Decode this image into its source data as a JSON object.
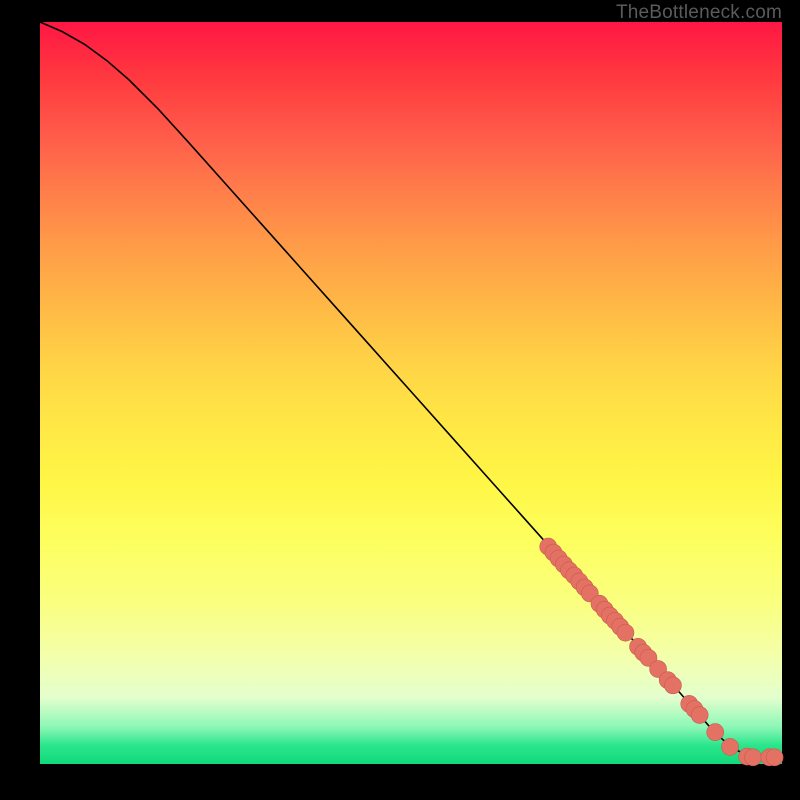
{
  "attribution": "TheBottleneck.com",
  "colors": {
    "background": "#000000",
    "marker_fill": "#e37264",
    "marker_stroke": "#c95a4e",
    "curve": "#000000"
  },
  "chart_data": {
    "type": "line",
    "title": "",
    "xlabel": "",
    "ylabel": "",
    "xlim": [
      0,
      100
    ],
    "ylim": [
      0,
      100
    ],
    "grid": false,
    "curve": {
      "x": [
        0,
        3,
        6,
        9,
        12,
        16,
        20,
        25,
        30,
        35,
        40,
        45,
        50,
        55,
        60,
        65,
        70,
        75,
        80,
        85,
        88,
        90,
        92,
        94,
        96,
        98,
        100
      ],
      "y": [
        100,
        98.7,
        97.0,
        94.8,
        92.2,
        88.2,
        83.8,
        78.2,
        72.6,
        67.0,
        61.4,
        55.8,
        50.2,
        44.6,
        39.0,
        33.4,
        27.8,
        22.2,
        16.6,
        11.0,
        7.6,
        5.3,
        3.3,
        1.8,
        1.0,
        0.9,
        0.9
      ]
    },
    "series": [
      {
        "name": "markers",
        "points": [
          {
            "x": 68.5,
            "y": 29.3
          },
          {
            "x": 69.2,
            "y": 28.5
          },
          {
            "x": 69.9,
            "y": 27.7
          },
          {
            "x": 70.6,
            "y": 26.9
          },
          {
            "x": 71.3,
            "y": 26.1
          },
          {
            "x": 72.0,
            "y": 25.4
          },
          {
            "x": 72.7,
            "y": 24.6
          },
          {
            "x": 73.4,
            "y": 23.8
          },
          {
            "x": 74.1,
            "y": 23.0
          },
          {
            "x": 75.4,
            "y": 21.6
          },
          {
            "x": 76.1,
            "y": 20.8
          },
          {
            "x": 76.8,
            "y": 20.0
          },
          {
            "x": 77.5,
            "y": 19.3
          },
          {
            "x": 78.2,
            "y": 18.5
          },
          {
            "x": 78.9,
            "y": 17.7
          },
          {
            "x": 80.6,
            "y": 15.8
          },
          {
            "x": 81.3,
            "y": 15.0
          },
          {
            "x": 82.0,
            "y": 14.3
          },
          {
            "x": 83.3,
            "y": 12.8
          },
          {
            "x": 84.6,
            "y": 11.3
          },
          {
            "x": 85.3,
            "y": 10.6
          },
          {
            "x": 87.5,
            "y": 8.1
          },
          {
            "x": 88.2,
            "y": 7.4
          },
          {
            "x": 88.9,
            "y": 6.6
          },
          {
            "x": 91.0,
            "y": 4.3
          },
          {
            "x": 93.0,
            "y": 2.3
          },
          {
            "x": 95.3,
            "y": 1.0
          },
          {
            "x": 96.1,
            "y": 0.9
          },
          {
            "x": 98.3,
            "y": 0.9
          },
          {
            "x": 99.0,
            "y": 0.9
          }
        ]
      }
    ]
  }
}
